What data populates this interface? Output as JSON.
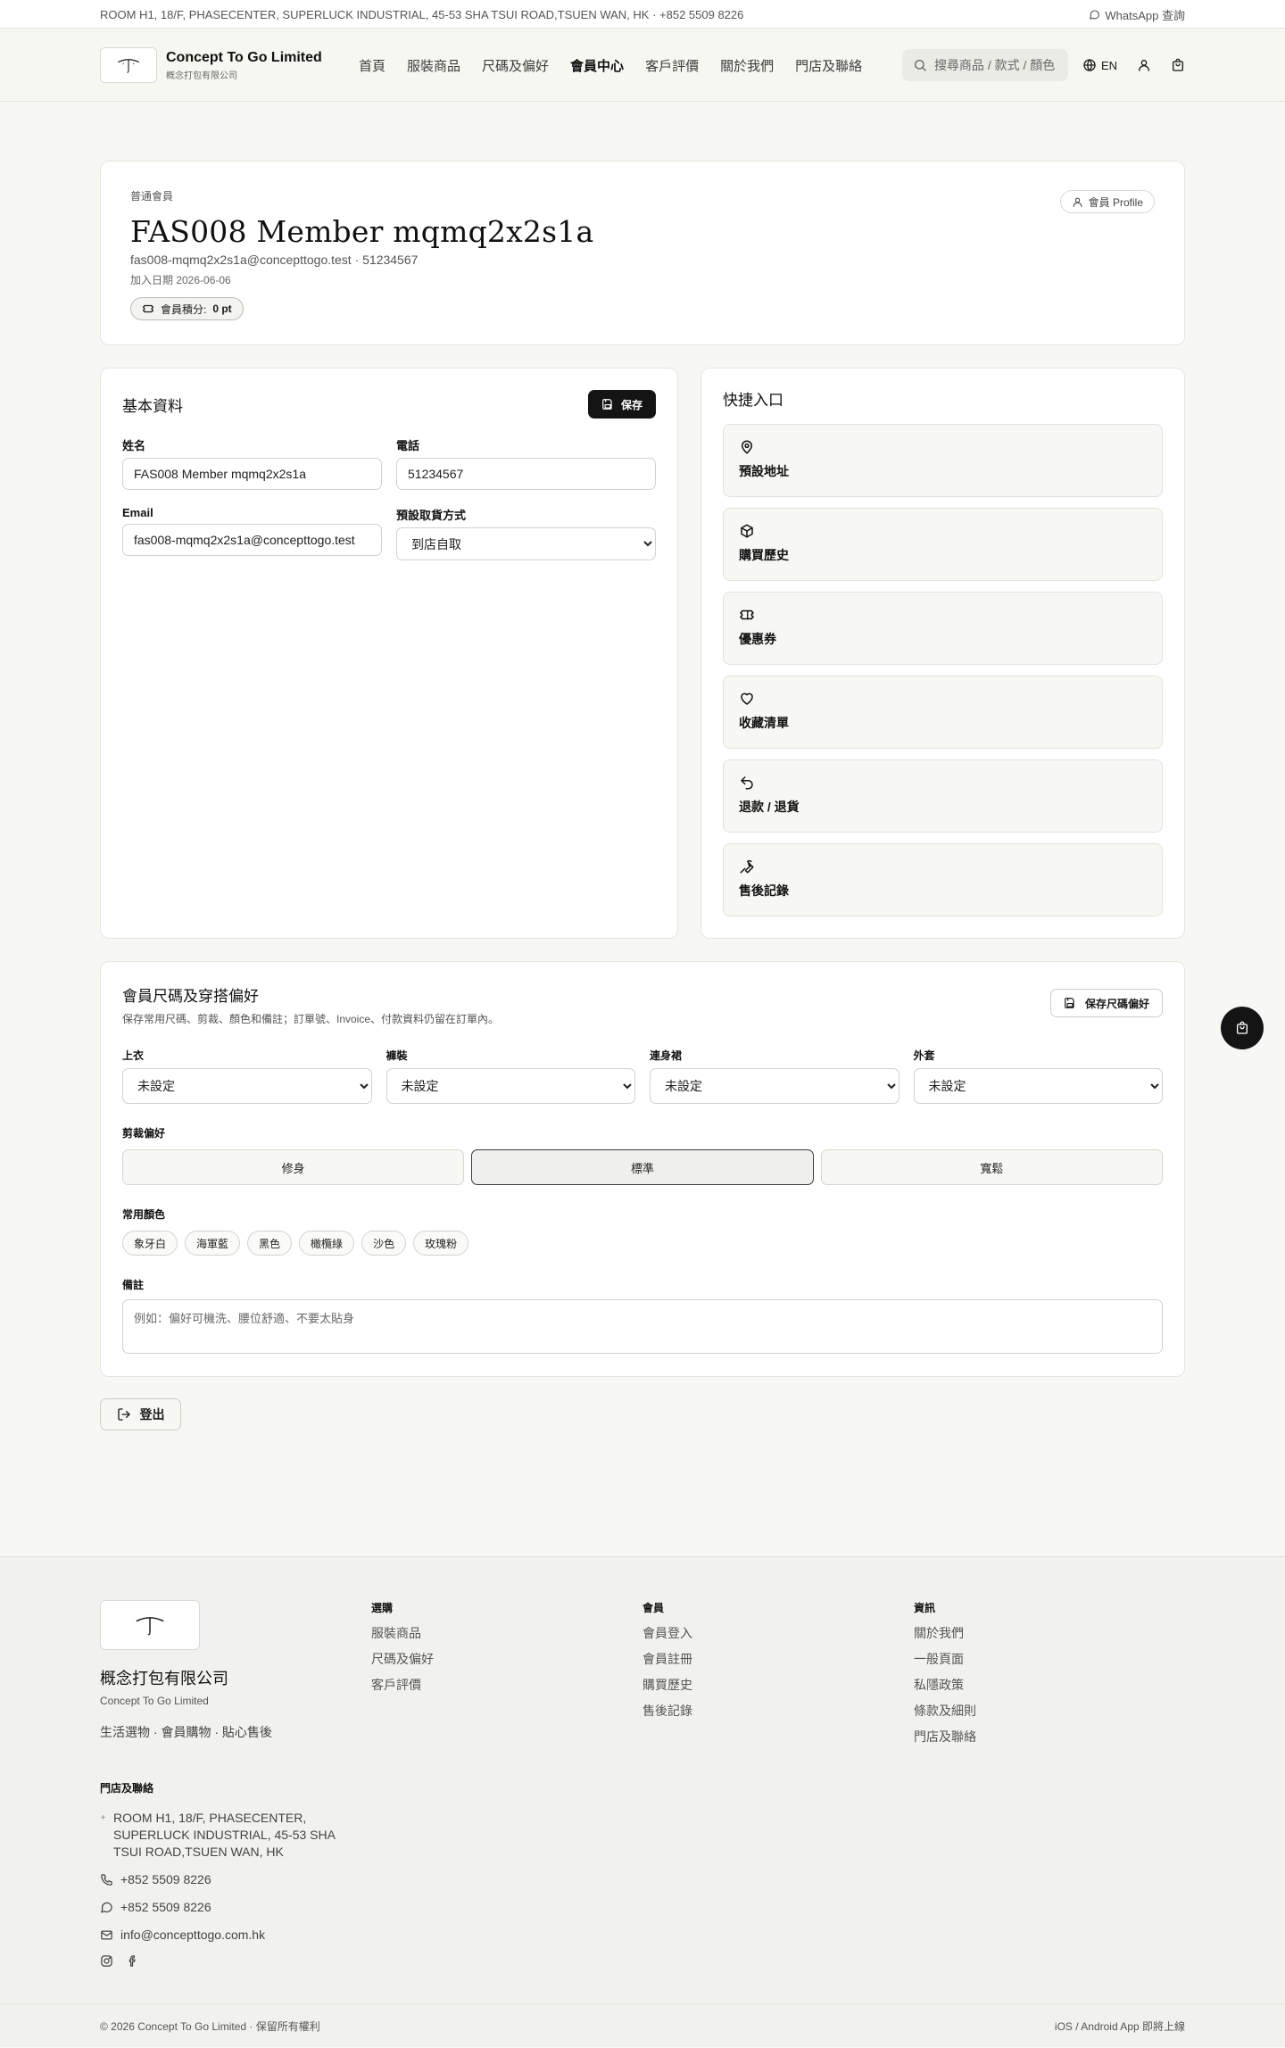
{
  "topbar": {
    "address": "ROOM H1, 18/F, PHASECENTER, SUPERLUCK INDUSTRIAL, 45-53 SHA TSUI ROAD,TSUEN WAN, HK · +852 5509 8226",
    "whatsapp": "WhatsApp 查詢"
  },
  "header": {
    "brand_name": "Concept To Go Limited",
    "brand_sub": "概念打包有限公司",
    "nav": [
      "首頁",
      "服裝商品",
      "尺碼及偏好",
      "會員中心",
      "客戶評價",
      "關於我們",
      "門店及聯絡"
    ],
    "active_nav": "會員中心",
    "search_placeholder": "搜尋商品 / 款式 / 顏色",
    "lang": "EN"
  },
  "profile": {
    "tier": "普通會員",
    "name": "FAS008 Member mqmq2x2s1a",
    "meta": "fas008-mqmq2x2s1a@concepttogo.test · 51234567",
    "join_date": "加入日期 2026-06-06",
    "points_label": "會員積分:",
    "points_value": "0 pt",
    "profile_pill": "會員 Profile"
  },
  "basic": {
    "title": "基本資料",
    "save": "保存",
    "name_label": "姓名",
    "name_value": "FAS008 Member mqmq2x2s1a",
    "phone_label": "電話",
    "phone_value": "51234567",
    "email_label": "Email",
    "email_value": "fas008-mqmq2x2s1a@concepttogo.test",
    "pickup_label": "預設取貨方式",
    "pickup_value": "到店自取"
  },
  "quick": {
    "title": "快捷入口",
    "items": [
      {
        "label": "預設地址",
        "icon": "map-pin-icon"
      },
      {
        "label": "購買歷史",
        "icon": "package-icon"
      },
      {
        "label": "優惠券",
        "icon": "ticket-icon"
      },
      {
        "label": "收藏清單",
        "icon": "heart-icon"
      },
      {
        "label": "退款 / 退貨",
        "icon": "undo-icon"
      },
      {
        "label": "售後記錄",
        "icon": "wrench-icon"
      }
    ]
  },
  "sizes": {
    "title": "會員尺碼及穿搭偏好",
    "desc": "保存常用尺碼、剪裁、顏色和備註；訂單號、Invoice、付款資料仍留在訂單內。",
    "save": "保存尺碼偏好",
    "fields": [
      {
        "label": "上衣",
        "value": "未設定"
      },
      {
        "label": "褲裝",
        "value": "未設定"
      },
      {
        "label": "連身裙",
        "value": "未設定"
      },
      {
        "label": "外套",
        "value": "未設定"
      }
    ],
    "fit_label": "剪裁偏好",
    "fits": [
      "修身",
      "標準",
      "寬鬆"
    ],
    "fit_selected": "標準",
    "color_label": "常用顏色",
    "colors": [
      "象牙白",
      "海軍藍",
      "黑色",
      "橄欖綠",
      "沙色",
      "玫瑰粉"
    ],
    "notes_label": "備註",
    "notes_placeholder": "例如：偏好可機洗、腰位舒適、不要太貼身"
  },
  "logout": "登出",
  "footer": {
    "name": "概念打包有限公司",
    "sub": "Concept To Go Limited",
    "tagline": "生活選物 · 會員購物 · 貼心售後",
    "cols": [
      {
        "title": "選購",
        "links": [
          "服裝商品",
          "尺碼及偏好",
          "客戶評價"
        ]
      },
      {
        "title": "會員",
        "links": [
          "會員登入",
          "會員註冊",
          "購買歷史",
          "售後記錄"
        ]
      },
      {
        "title": "資訊",
        "links": [
          "關於我們",
          "一般頁面",
          "私隱政策",
          "條款及細則",
          "門店及聯絡"
        ]
      }
    ],
    "contact_title": "門店及聯絡",
    "address_lines": [
      "ROOM H1, 18/F, PHASECENTER,",
      "SUPERLUCK INDUSTRIAL, 45-53 SHA",
      "TSUI ROAD,TSUEN WAN, HK"
    ],
    "phone": "+852 5509 8226",
    "whatsapp": "+852 5509 8226",
    "email": "info@concepttogo.com.hk",
    "copyright": "© 2026 Concept To Go Limited · 保留所有權利",
    "app_note": "iOS / Android App 即將上線"
  }
}
